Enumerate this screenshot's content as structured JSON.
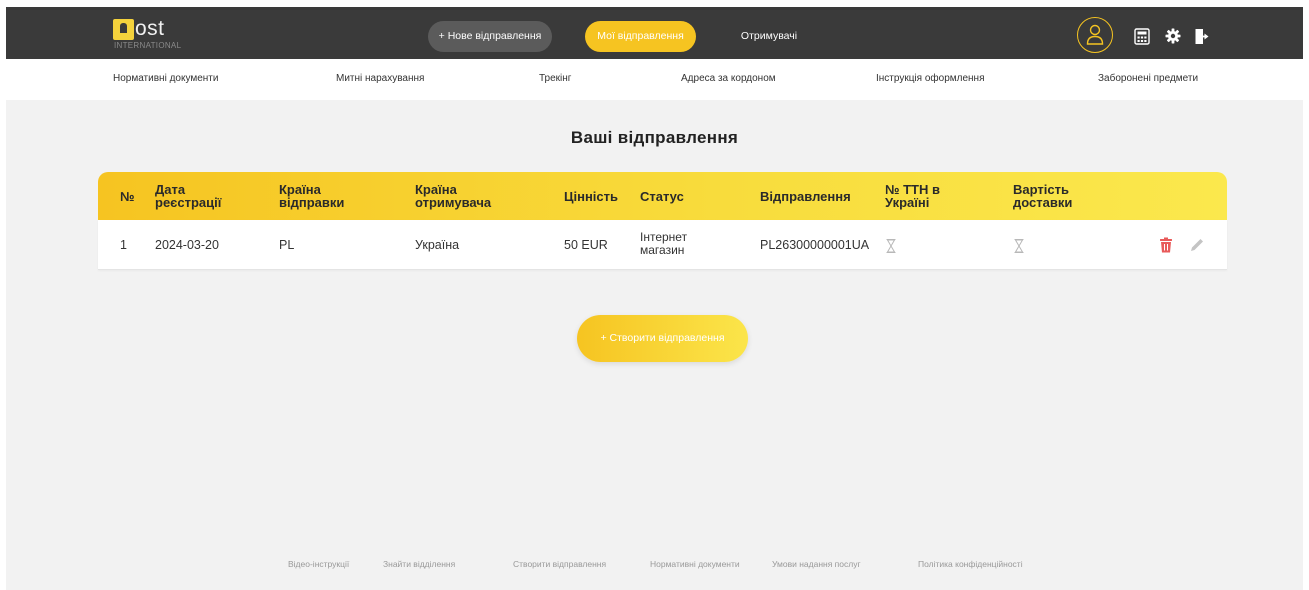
{
  "brand": {
    "logo_text": "ost",
    "logo_sub": "INTERNATIONAL"
  },
  "top_nav": {
    "new_shipment": "+ Нове відправлення",
    "my_shipments": "Мої відправлення",
    "recipients": "Отримувачі"
  },
  "icons": {
    "avatar": "user-icon",
    "calculator": "calculator-icon",
    "settings": "gear-icon",
    "logout": "logout-icon"
  },
  "sub_nav": [
    "Нормативні документи",
    "Митні нарахування",
    "Трекінг",
    "Адреса за кордоном",
    "Інструкція оформлення",
    "Заборонені предмети"
  ],
  "page": {
    "title": "Ваші відправлення"
  },
  "table": {
    "headers": {
      "num": "№",
      "reg_date_1": "Дата",
      "reg_date_2": "реєстрації",
      "send_country_1": "Країна",
      "send_country_2": "відправки",
      "recv_country_1": "Країна",
      "recv_country_2": "отримувача",
      "value": "Цінність",
      "status": "Статус",
      "shipment": "Відправлення",
      "ttn_1": "№ ТТН в",
      "ttn_2": "Україні",
      "cost_1": "Вартість",
      "cost_2": "доставки"
    },
    "rows": [
      {
        "num": "1",
        "date": "2024-03-20",
        "send_country": "PL",
        "recv_country": "Україна",
        "value": "50 EUR",
        "status_1": "Інтернет",
        "status_2": "магазин",
        "shipment": "PL26300000001UA"
      }
    ]
  },
  "create_button": "+ Створити відправлення",
  "footer": [
    "Відео-інструкції",
    "Знайти відділення",
    "Створити відправлення",
    "Нормативні документи",
    "Умови надання послуг",
    "Політика конфіденційності"
  ],
  "colors": {
    "accent": "#f6c421",
    "topbar": "#3a3a3a",
    "delete": "#e85a5a"
  }
}
